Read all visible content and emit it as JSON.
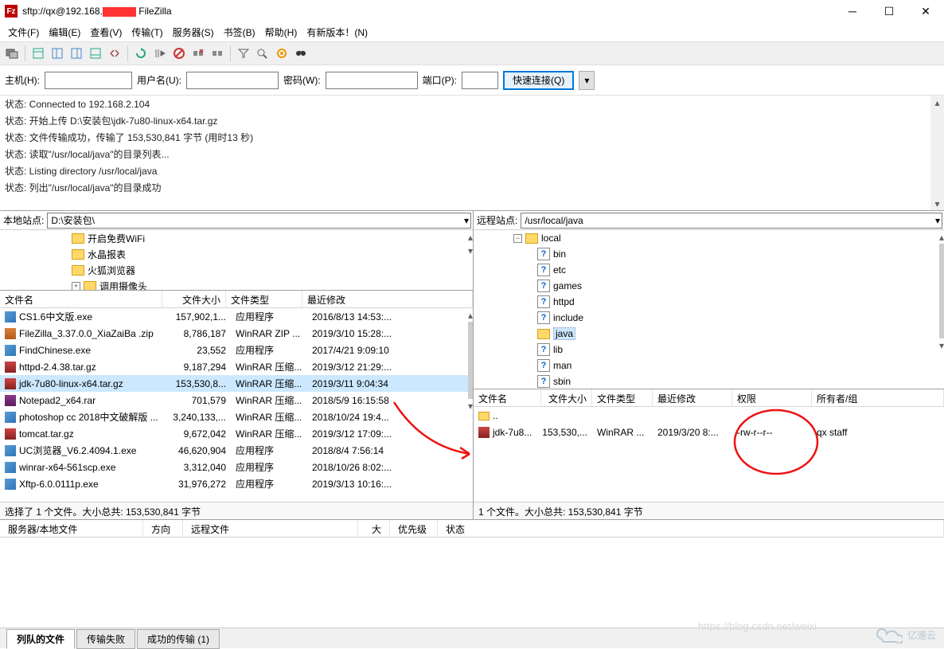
{
  "title_prefix": "sftp://qx@192.168.",
  "title_suffix": "FileZilla",
  "menu": [
    "文件(F)",
    "编辑(E)",
    "查看(V)",
    "传输(T)",
    "服务器(S)",
    "书签(B)",
    "帮助(H)",
    "有新版本！(N)"
  ],
  "quick": {
    "host": "主机(H):",
    "user": "用户名(U):",
    "pass": "密码(W):",
    "port": "端口(P):",
    "connect": "快速连接(Q)"
  },
  "log": [
    "状态: Connected to 192.168.2.104",
    "状态: 开始上传 D:\\安装包\\jdk-7u80-linux-x64.tar.gz",
    "状态: 文件传输成功，传输了 153,530,841 字节 (用时13 秒)",
    "状态: 读取\"/usr/local/java\"的目录列表...",
    "状态: Listing directory /usr/local/java",
    "状态: 列出\"/usr/local/java\"的目录成功"
  ],
  "local": {
    "label": "本地站点:",
    "path": "D:\\安装包\\",
    "tree": [
      "开启免费WiFi",
      "水晶报表",
      "火狐浏览器",
      "调用摄像头"
    ],
    "cols": [
      "文件名",
      "文件大小",
      "文件类型",
      "最近修改"
    ],
    "files": [
      {
        "icon": "exe",
        "name": "CS1.6中文版.exe",
        "size": "157,902,1...",
        "type": "应用程序",
        "date": "2016/8/13 14:53:..."
      },
      {
        "icon": "zip",
        "name": "FileZilla_3.37.0.0_XiaZaiBa .zip",
        "size": "8,786,187",
        "type": "WinRAR ZIP ...",
        "date": "2019/3/10 15:28:..."
      },
      {
        "icon": "exe",
        "name": "FindChinese.exe",
        "size": "23,552",
        "type": "应用程序",
        "date": "2017/4/21 9:09:10"
      },
      {
        "icon": "gz",
        "name": "httpd-2.4.38.tar.gz",
        "size": "9,187,294",
        "type": "WinRAR 压缩...",
        "date": "2019/3/12 21:29:..."
      },
      {
        "icon": "gz",
        "name": "jdk-7u80-linux-x64.tar.gz",
        "size": "153,530,8...",
        "type": "WinRAR 压缩...",
        "date": "2019/3/11 9:04:34",
        "sel": true
      },
      {
        "icon": "rar",
        "name": "Notepad2_x64.rar",
        "size": "701,579",
        "type": "WinRAR 压缩...",
        "date": "2018/5/9 16:15:58"
      },
      {
        "icon": "exe",
        "name": "photoshop cc 2018中文破解版 ...",
        "size": "3,240,133,...",
        "type": "WinRAR 压缩...",
        "date": "2018/10/24 19:4..."
      },
      {
        "icon": "gz",
        "name": "tomcat.tar.gz",
        "size": "9,672,042",
        "type": "WinRAR 压缩...",
        "date": "2019/3/12 17:09:..."
      },
      {
        "icon": "exe",
        "name": "UC浏览器_V6.2.4094.1.exe",
        "size": "46,620,904",
        "type": "应用程序",
        "date": "2018/8/4 7:56:14"
      },
      {
        "icon": "exe",
        "name": "winrar-x64-561scp.exe",
        "size": "3,312,040",
        "type": "应用程序",
        "date": "2018/10/26 8:02:..."
      },
      {
        "icon": "exe",
        "name": "Xftp-6.0.0111p.exe",
        "size": "31,976,272",
        "type": "应用程序",
        "date": "2019/3/13 10:16:..."
      }
    ],
    "status": "选择了 1 个文件。大小总共: 153,530,841 字节"
  },
  "remote": {
    "label": "远程站点:",
    "path": "/usr/local/java",
    "tree_root": "local",
    "tree": [
      "bin",
      "etc",
      "games",
      "httpd",
      "include",
      "java",
      "lib",
      "man",
      "sbin"
    ],
    "cols": [
      "文件名",
      "文件大小",
      "文件类型",
      "最近修改",
      "权限",
      "所有者/组"
    ],
    "parent": "..",
    "files": [
      {
        "icon": "gz",
        "name": "jdk-7u8...",
        "size": "153,530,...",
        "type": "WinRAR ...",
        "date": "2019/3/20 8:...",
        "perm": "-rw-r--r--",
        "owner": "qx staff"
      }
    ],
    "status": "1 个文件。大小总共: 153,530,841 字节"
  },
  "queue": {
    "cols": [
      "服务器/本地文件",
      "方向",
      "远程文件",
      "大小",
      "优先级",
      "状态"
    ]
  },
  "tabs": [
    "列队的文件",
    "传输失败",
    "成功的传输 (1)"
  ],
  "watermark": "亿速云",
  "watermark_url": "https://blog.csdn.net/weixi"
}
